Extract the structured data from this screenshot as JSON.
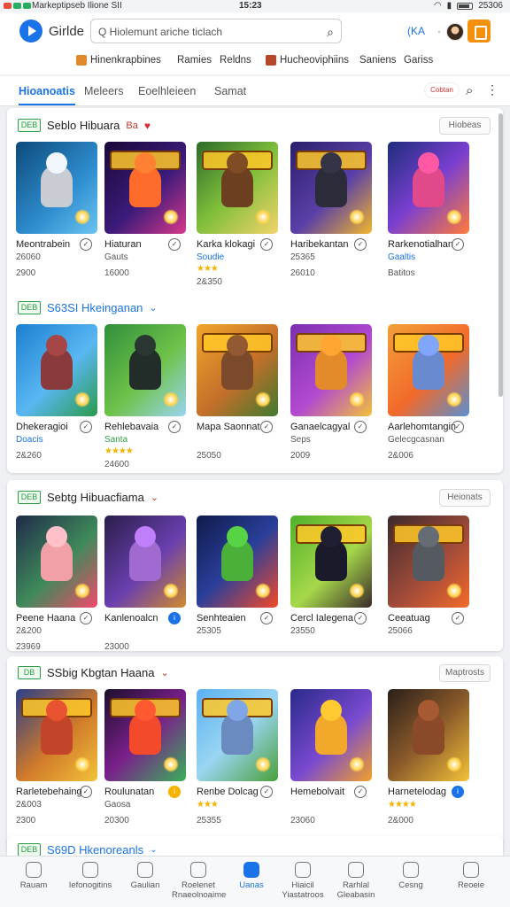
{
  "status": {
    "left": "Markeptipseb  Ilione  SII",
    "time": "15:23",
    "battery": "25306"
  },
  "header": {
    "brand": "Girlde",
    "search_placeholder": "Q  Hiolemunt ariche  ticlach",
    "lang": "(KA",
    "menu": "·"
  },
  "categories": [
    {
      "label": "Hinenkrapbines",
      "color": "#e08a2e"
    },
    {
      "label": "Ramies"
    },
    {
      "label": "Reldns"
    },
    {
      "label": "Hucheoviphiins",
      "color": "#b5482a"
    },
    {
      "label": "Saniens"
    },
    {
      "label": "Gariss"
    }
  ],
  "tabs": {
    "items": [
      "Hioanoatis",
      "Meleers",
      "Eoelhleieen",
      "Samat"
    ],
    "badge": "Cobtan"
  },
  "sections": [
    {
      "tag": "DEB",
      "title": "Seblo Hibuara",
      "title_suffix": "Ba",
      "heart": "♥",
      "button": "Hiobeas",
      "title_blue": false,
      "cards": [
        {
          "name": "Meontrabein",
          "sub": "26060",
          "meta1": "2900",
          "bg": "linear-gradient(135deg,#0d4a7a,#2f8ed0 60%,#6cc4f0)",
          "fig": "#c9ccd2"
        },
        {
          "name": "Hiaturan",
          "sub": "Gauts",
          "meta1": "16000",
          "bg": "linear-gradient(135deg,#1a0838,#3b1b7a 55%,#d8388a)",
          "fig": "#ff6b2a",
          "title": true
        },
        {
          "name": "Karka klokagi",
          "sub": "Soudie",
          "stars": "★★★",
          "meta1": "2&350",
          "bg": "linear-gradient(135deg,#2c6a2a,#7fbf3a 50%,#f3d36a)",
          "fig": "#6b3f1f",
          "title": true,
          "subblue": true
        },
        {
          "name": "Haribekantan",
          "sub": "25365",
          "meta1": "26010",
          "bg": "linear-gradient(135deg,#2b1f6a,#5a3fa8 55%,#f2b72b)",
          "fig": "#2b2b3a",
          "title": true
        },
        {
          "name": "Rarkenotialhan",
          "sub": "Gaaltis",
          "meta1": "Batitos",
          "bg": "linear-gradient(135deg,#1c2d7a,#7a3fd0 50%,#ff7b3a)",
          "fig": "#e04a8a",
          "subblue": true
        }
      ]
    },
    {
      "tag": "DEB",
      "title": "S63SI Hkeinganan",
      "title_suffix": "⌄",
      "button": "",
      "title_blue": true,
      "cards": [
        {
          "name": "Dhekeragioi",
          "sub": "Doacis",
          "meta1": "2&260",
          "bg": "linear-gradient(135deg,#1c7fd0,#59b7f2 55%,#2b9a4a)",
          "fig": "#8a3a3a",
          "subblue": true
        },
        {
          "name": "Rehlebavaia",
          "sub": "Santa",
          "stars": "★★★★",
          "meta1": "24600",
          "bg": "linear-gradient(135deg,#2f8f3a,#6fc24a 55%,#9ad5f2)",
          "fig": "#222d2a",
          "subgreen": true
        },
        {
          "name": "Mapa Saonnat",
          "sub": "",
          "meta1": "25050",
          "bg": "linear-gradient(135deg,#f2a52a,#c46f2a 55%,#3f7a2f)",
          "fig": "#7a4a2a",
          "title": true
        },
        {
          "name": "Ganaelcagyal",
          "sub": "Seps",
          "meta1": "2009",
          "bg": "linear-gradient(135deg,#7a2fb0,#b24ad0 55%,#f2c23a)",
          "fig": "#e38a2a",
          "title": true
        },
        {
          "name": "Aarlehomtangin",
          "sub": "Gelecgcasnan",
          "meta1": "2&006",
          "bg": "linear-gradient(135deg,#f2a03a,#f26a2a 55%,#5a8fd0)",
          "fig": "#6a8ad0",
          "title": true
        }
      ]
    },
    {
      "tag": "DEB",
      "title": "Sebtg Hibuacfiama",
      "title_suffix": "⌄",
      "button": "Heionats",
      "title_blue": false,
      "cards": [
        {
          "name": "Peene Haana",
          "sub": "2&200",
          "meta1": "23969",
          "bg": "linear-gradient(135deg,#1f2a4a,#3f8a5a 55%,#f24a6a)",
          "fig": "#f2a0a8"
        },
        {
          "name": "Kanlenoalcn",
          "sub": "",
          "meta1": "23000",
          "bg": "linear-gradient(135deg,#2a1f4a,#6a3fb0 55%,#d08a2a)",
          "fig": "#a06ad0",
          "infofill": true
        },
        {
          "name": "Senhteaien",
          "sub": "25305",
          "meta1": "",
          "bg": "linear-gradient(135deg,#0f1a4a,#2a3f9a 50%,#f24a2a)",
          "fig": "#4ab03a"
        },
        {
          "name": "Cercl Ialegena",
          "sub": "23550",
          "meta1": "",
          "bg": "linear-gradient(135deg,#4fb02a,#a6d84a 55%,#3a2a2a)",
          "fig": "#1a1a2a",
          "title": true
        },
        {
          "name": "Ceeatuag",
          "sub": "25066",
          "meta1": "",
          "bg": "linear-gradient(135deg,#3a2a2a,#a04a3a 55%,#f26a2a)",
          "fig": "#555a60",
          "title": true
        }
      ]
    },
    {
      "tag": "DB",
      "title": "SSbig Kbgtan Haana",
      "title_suffix": "⌄",
      "button": "Maptrosts",
      "title_blue": false,
      "cards": [
        {
          "name": "Rarletebehaing",
          "sub": "2&003",
          "meta1": "2300",
          "bg": "linear-gradient(135deg,#2a3f8a,#d07a2a 55%,#f2c23a)",
          "fig": "#c2452a",
          "title": true
        },
        {
          "name": "Roulunatan",
          "sub": "Gaosa",
          "meta1": "20300",
          "bg": "linear-gradient(135deg,#1a0f2a,#7a1f8a 50%,#3ab05a)",
          "fig": "#f24a2a",
          "title": true,
          "infogold": true
        },
        {
          "name": "Renbe Dolcag",
          "sub": "",
          "stars": "★★★",
          "meta1": "25355",
          "bg": "linear-gradient(135deg,#5ab0f2,#9ad5f2 50%,#4aa03a)",
          "fig": "#6a8ac0",
          "title": true
        },
        {
          "name": "Hemebolvait",
          "sub": "",
          "meta1": "23060",
          "bg": "linear-gradient(135deg,#2a2a8a,#7a4ad0 55%,#f2a02a)",
          "fig": "#f2a82a"
        },
        {
          "name": "Harnetelodag",
          "sub": "",
          "stars": "★★★★",
          "meta1": "2&000",
          "bg": "linear-gradient(135deg,#2a1f1a,#8a5a2a 50%,#f2c23a)",
          "fig": "#8a4a2a",
          "infofill": true
        }
      ]
    }
  ],
  "last_section": {
    "tag": "DEB",
    "title": "S69D Hkenoreanls",
    "title_suffix": "⌄"
  },
  "bottom_nav": [
    {
      "label": "Rauam"
    },
    {
      "label": "Iefonogitins"
    },
    {
      "label": "Gaulian"
    },
    {
      "label": "Roelenet Rnaeolnoaime"
    },
    {
      "label": "Uanas",
      "active": true
    },
    {
      "label": "Hiaicil Yiastatroos"
    },
    {
      "label": "Rarhlal Gleabasin"
    },
    {
      "label": "Cesng"
    },
    {
      "label": "Reoeie"
    }
  ]
}
